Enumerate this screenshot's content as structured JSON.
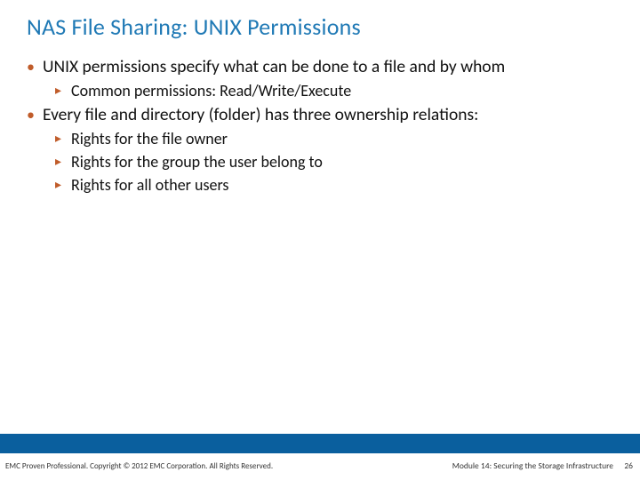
{
  "title": "NAS File Sharing: UNIX Permissions",
  "bullets": [
    {
      "text": "UNIX permissions specify what can be done to a file and by whom",
      "children": [
        {
          "text": "Common permissions: Read/Write/Execute"
        }
      ]
    },
    {
      "text": "Every file and directory (folder) has three ownership relations:",
      "children": [
        {
          "text": "Rights for the file owner"
        },
        {
          "text": "Rights for the group the user belong to"
        },
        {
          "text": "Rights for all other users"
        }
      ]
    }
  ],
  "footer": {
    "left": "EMC Proven Professional. Copyright © 2012 EMC Corporation. All Rights Reserved.",
    "right": "Module 14: Securing the Storage Infrastructure",
    "page": "26"
  }
}
